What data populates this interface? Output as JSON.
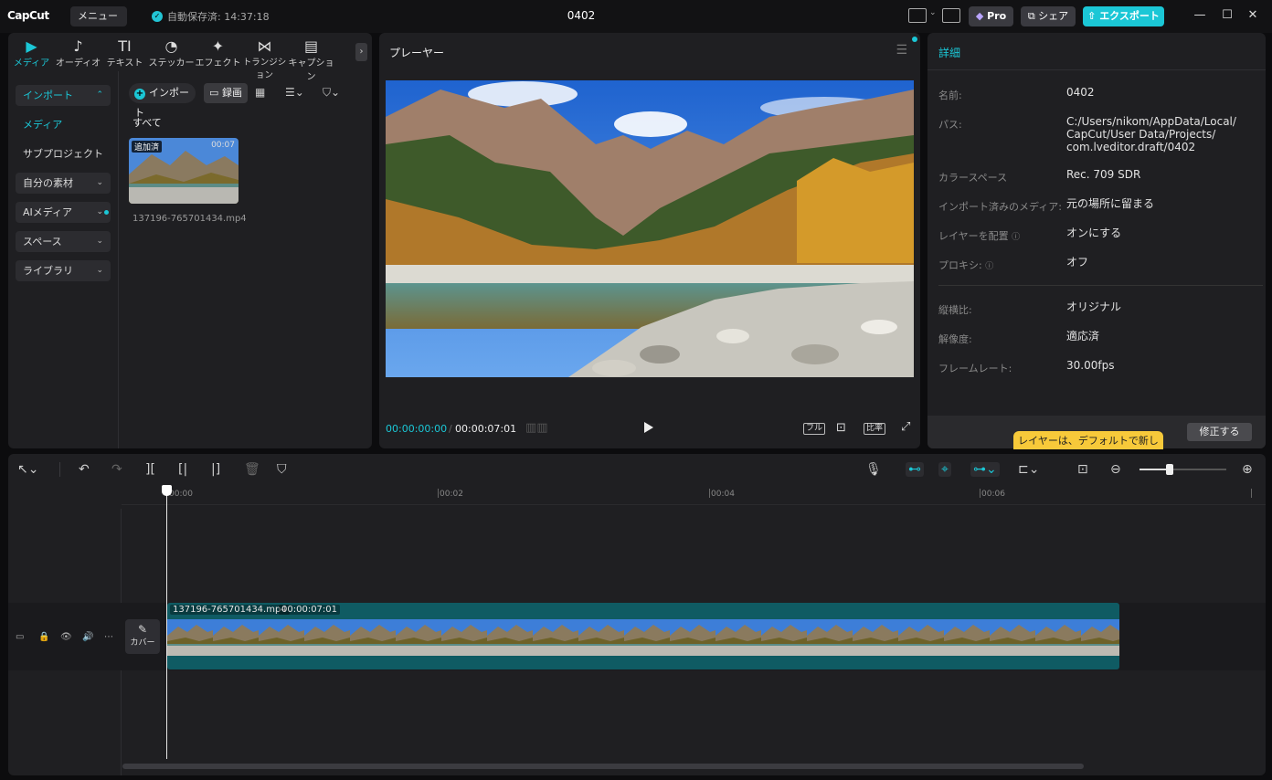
{
  "titlebar": {
    "logo": "CapCut",
    "menu_label": "メニュー",
    "autosave": "自動保存済: 14:37:18",
    "project_name": "0402",
    "pro_label": "Pro",
    "share_label": "シェア",
    "export_label": "エクスポート"
  },
  "media_tabs": [
    {
      "label": "メディア",
      "icon": "▶"
    },
    {
      "label": "オーディオ",
      "icon": "♪"
    },
    {
      "label": "テキスト",
      "icon": "TI"
    },
    {
      "label": "ステッカー",
      "icon": "◔"
    },
    {
      "label": "エフェクト",
      "icon": "✦"
    },
    {
      "label": "トランジション",
      "icon": "⋈"
    },
    {
      "label": "キャプション",
      "icon": "▤"
    }
  ],
  "sidebar": {
    "import": "インポート",
    "media": "メディア",
    "subproject": "サブプロジェクト",
    "my_assets": "自分の素材",
    "ai_media": "AIメディア",
    "space": "スペース",
    "library": "ライブラリ"
  },
  "media_panel": {
    "import_button": "インポート",
    "record_button": "録画",
    "all_label": "すべて",
    "thumb_badge": "追加済",
    "thumb_duration": "00:07",
    "file_name": "137196-765701434.mp4"
  },
  "player": {
    "title": "プレーヤー",
    "current_time": "00:00:00:00",
    "total_time": "00:00:07:01",
    "full_label": "フル",
    "ratio_label": "比率"
  },
  "details": {
    "header": "詳細",
    "rows": [
      {
        "label": "名前:",
        "value": "0402"
      },
      {
        "label": "パス:",
        "value": "C:/Users/nikom/AppData/Local/\nCapCut/User Data/Projects/\ncom.lveditor.draft/0402"
      },
      {
        "label": "カラースペース",
        "value": "Rec. 709 SDR"
      },
      {
        "label": "インポート済みのメディア:",
        "value": "元の場所に留まる"
      },
      {
        "label": "レイヤーを配置",
        "value": "オンにする"
      },
      {
        "label": "プロキシ:",
        "value": "オフ"
      },
      {
        "label": "縦横比:",
        "value": "オリジナル"
      },
      {
        "label": "解像度:",
        "value": "適応済"
      },
      {
        "label": "フレームレート:",
        "value": "30.00fps"
      }
    ],
    "tooltip": "レイヤーは、デフォルトで新しい",
    "fix_button": "修正する"
  },
  "timeline": {
    "ruler_ticks": [
      "00:00",
      "00:02",
      "00:04",
      "00:06"
    ],
    "cover_label": "カバー",
    "clip_name": "137196-765701434.mp4",
    "clip_duration": "00:00:07:01"
  },
  "colors": {
    "accent": "#1bc7d6",
    "clip": "#0f5b63",
    "panel": "#1f1f22"
  }
}
